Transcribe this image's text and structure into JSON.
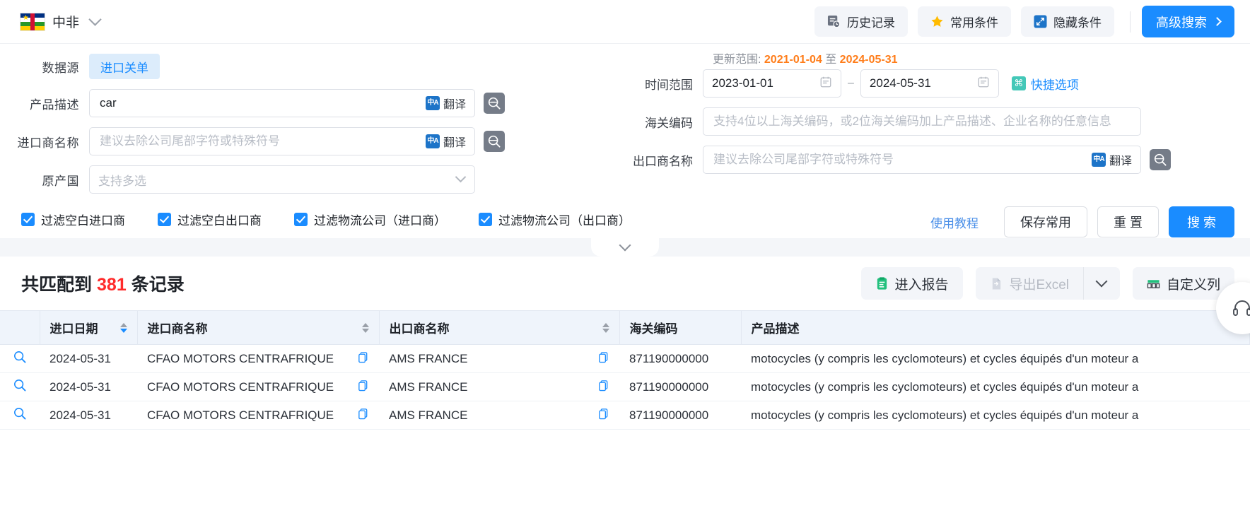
{
  "topbar": {
    "country": "中非",
    "country_flag": "central-african-republic",
    "buttons": [
      {
        "label": "历史记录",
        "icon": "history-icon"
      },
      {
        "label": "常用条件",
        "icon": "star-icon"
      },
      {
        "label": "隐藏条件",
        "icon": "collapse-icon"
      }
    ],
    "advanced_search": "高级搜索"
  },
  "search": {
    "datasource_label": "数据源",
    "datasource_value": "进口关单",
    "product_label": "产品描述",
    "product_value": "car",
    "importer_label": "进口商名称",
    "importer_placeholder": "建议去除公司尾部字符或特殊符号",
    "origin_label": "原产国",
    "origin_placeholder": "支持多选",
    "translate_label": "翻译",
    "update_range_prefix": "更新范围:",
    "update_range_start": "2021-01-04",
    "update_range_mid": "至",
    "update_range_end": "2024-05-31",
    "time_label": "时间范围",
    "date_start": "2023-01-01",
    "date_end": "2024-05-31",
    "quick_option": "快捷选项",
    "hs_label": "海关编码",
    "hs_placeholder": "支持4位以上海关编码，或2位海关编码加上产品描述、企业名称的任意信息",
    "exporter_label": "出口商名称",
    "exporter_placeholder": "建议去除公司尾部字符或特殊符号",
    "checkboxes": [
      {
        "label": "过滤空白进口商",
        "checked": true
      },
      {
        "label": "过滤空白出口商",
        "checked": true
      },
      {
        "label": "过滤物流公司（进口商）",
        "checked": true
      },
      {
        "label": "过滤物流公司（出口商）",
        "checked": true
      }
    ],
    "tutorial_link": "使用教程",
    "save_label": "保存常用",
    "reset_label": "重 置",
    "submit_label": "搜 索"
  },
  "results": {
    "count_prefix": "共匹配到",
    "count": "381",
    "count_suffix": "条记录",
    "report_button": "进入报告",
    "export_button": "导出Excel",
    "columns_button": "自定义列",
    "table": {
      "headers": [
        "进口日期",
        "进口商名称",
        "出口商名称",
        "海关编码",
        "产品描述"
      ],
      "sortable": [
        true,
        true,
        true,
        false,
        false
      ],
      "rows": [
        {
          "date": "2024-05-31",
          "importer": "CFAO MOTORS CENTRAFRIQUE",
          "exporter": "AMS FRANCE",
          "hs": "871190000000",
          "product": "motocycles (y compris les cyclomoteurs) et cycles équipés d'un moteur a"
        },
        {
          "date": "2024-05-31",
          "importer": "CFAO MOTORS CENTRAFRIQUE",
          "exporter": "AMS FRANCE",
          "hs": "871190000000",
          "product": "motocycles (y compris les cyclomoteurs) et cycles équipés d'un moteur a"
        },
        {
          "date": "2024-05-31",
          "importer": "CFAO MOTORS CENTRAFRIQUE",
          "exporter": "AMS FRANCE",
          "hs": "871190000000",
          "product": "motocycles (y compris les cyclomoteurs) et cycles équipés d'un moteur a"
        }
      ]
    }
  },
  "colors": {
    "accent": "#1a8cff",
    "danger": "#ff2b2b",
    "orange": "#ff7d1a",
    "header_bg": "#eff4fb"
  }
}
